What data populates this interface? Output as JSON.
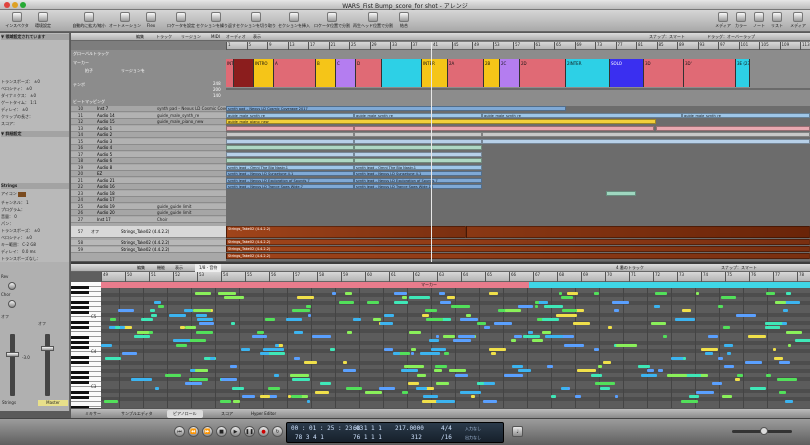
{
  "window": {
    "title": "WARS_Fist Bump_score_for shot - アレンジ"
  },
  "toolbar": {
    "left": [
      "インスペクタ",
      "環境設定",
      "自動的に拡大/縮小",
      "オートメーション",
      "Flex"
    ],
    "mid": [
      "ロケータを設定",
      "セクションを繰り返す",
      "セクションを切り取り",
      "セクションを挿入",
      "ロケータ位置で分割",
      "再生ヘッド位置で分割",
      "結合"
    ],
    "right": [
      "メディア",
      "カラー",
      "ノート",
      "リスト",
      "メディア"
    ]
  },
  "arrange_bar": {
    "items": [
      "編集",
      "トラック",
      "リージョン",
      "MIDI",
      "オーディオ",
      "表示"
    ],
    "snap": "スナップ：スマート",
    "drag": "ドラッグ：オーバーラップ"
  },
  "ruler_ticks": [
    "1",
    "5",
    "9",
    "13",
    "17",
    "21",
    "25",
    "29",
    "33",
    "37",
    "41",
    "45",
    "49",
    "53",
    "57",
    "61",
    "65",
    "69",
    "73",
    "77",
    "81",
    "85",
    "89",
    "93",
    "97",
    "101",
    "105",
    "109",
    "113"
  ],
  "globals": {
    "labels": [
      "グローバルトラック",
      "マーカー",
      "拍子",
      "リージョンを",
      "テンポ",
      "ビートマッピング"
    ],
    "tempo_values": [
      "248",
      "200",
      "140"
    ]
  },
  "markers": [
    {
      "label": "INTRO",
      "color": "#e06a75"
    },
    {
      "label": "",
      "color": "#8b1d1d"
    },
    {
      "label": "INTRO",
      "color": "#f5c518"
    },
    {
      "label": "A",
      "color": "#e06a75"
    },
    {
      "label": "B",
      "color": "#f5c518"
    },
    {
      "label": "C",
      "color": "#b47df0"
    },
    {
      "label": "D",
      "color": "#e06a75"
    },
    {
      "label": "",
      "color": "#2dd0e6"
    },
    {
      "label": "INTER",
      "color": "#f5c518"
    },
    {
      "label": "2A",
      "color": "#e06a75"
    },
    {
      "label": "2B",
      "color": "#f5c518"
    },
    {
      "label": "2C",
      "color": "#b47df0"
    },
    {
      "label": "2D",
      "color": "#e06a75"
    },
    {
      "label": "2INTER",
      "color": "#2dd0e6"
    },
    {
      "label": "SOLO",
      "color": "#3a2ff0"
    },
    {
      "label": "3D",
      "color": "#e06a75"
    },
    {
      "label": "3D'",
      "color": "#e06a75"
    },
    {
      "label": "3E (23 T",
      "color": "#2dd0e6"
    }
  ],
  "tracks": [
    {
      "num": "10",
      "name": "Inst 7",
      "region": "synth pad – Nexus LD Cosmic Coverage 2017"
    },
    {
      "num": "11",
      "name": "Audio 14",
      "region": "guide_male_synth_re"
    },
    {
      "num": "12",
      "name": "Audio 15",
      "region": "guide_male_piano_new"
    },
    {
      "num": "13",
      "name": "Audio 1",
      "region": ""
    },
    {
      "num": "14",
      "name": "Audio 2",
      "region": ""
    },
    {
      "num": "15",
      "name": "Audio 3",
      "region": ""
    },
    {
      "num": "16",
      "name": "Audio 4",
      "region": ""
    },
    {
      "num": "17",
      "name": "Audio 5",
      "region": ""
    },
    {
      "num": "18",
      "name": "Audio 6",
      "region": ""
    },
    {
      "num": "19",
      "name": "Audio 8",
      "region": ""
    },
    {
      "num": "20",
      "name": "EZ",
      "region": ""
    },
    {
      "num": "21",
      "name": "Audio 21",
      "region": ""
    },
    {
      "num": "22",
      "name": "Audio 16",
      "region": ""
    },
    {
      "num": "23",
      "name": "Audio 18",
      "region": ""
    },
    {
      "num": "24",
      "name": "Audio 17",
      "region": ""
    },
    {
      "num": "25",
      "name": "Audio 19",
      "region": "guide_guide limit"
    },
    {
      "num": "26",
      "name": "Audio 20",
      "region": "guide_guide limit"
    },
    {
      "num": "27",
      "name": "Inst 17",
      "region": "Choir"
    }
  ],
  "strings_track": {
    "num": "57",
    "name": "Strings_Take02 (4.4.2.2)",
    "off": "オフ"
  },
  "strings_track_2": {
    "num": "58",
    "name": "Strings_Take02 (4.4.2.2)"
  },
  "strings_track_3": {
    "num": "59",
    "name": "Strings_Take02 (4.4.2.2)"
  },
  "regions_text": [
    "synth pad – Nexus LD Cosmic Coverage 2017",
    "guide_male_synth_re",
    "guide_male_piano_new",
    "synth lead – Omni The Big Nasty.1",
    "synth lead – Nexus LD Sunsetune 4.1",
    "synth lead – Nexus LD Exploration of Sounds.7",
    "synth lead – Nexus LD Trance Saws Wide.7",
    "synth lead – Nexus LD Trance Saws Wide.10",
    "Strings_Take02 (4.4.2.2)"
  ],
  "inspector": {
    "header": "▼ 領域設定されています",
    "rows": [
      "トランスポーズ：",
      "ベロシティ：",
      "ダイナミクス：",
      "ゲートタイム：",
      "ディレイ：",
      "クリップの長さ：",
      "スコア："
    ],
    "values": [
      "±0",
      "±0",
      "±0",
      "1:1",
      "±0",
      "",
      ""
    ],
    "track_header": "▼ 詳細設定",
    "track_name": "Strings",
    "icon": "アイコン",
    "mix_labels": [
      "チャンネル：",
      "プログラム：",
      "音量：",
      "パン：",
      "トランスポーズ：",
      "ベロシティ：",
      "キー範囲：",
      "ディレイ：",
      "トランスポーズなし：",
      "リセットなし：",
      "スタイル："
    ],
    "mix_values": [
      "1",
      "",
      "0",
      "",
      "±0",
      "±0",
      "C-2 G8",
      "0.0 ms",
      "",
      "",
      "Auto"
    ]
  },
  "editor": {
    "bar_items": [
      "編集",
      "機能",
      "表示"
    ],
    "quantize": "1/8 - 音符",
    "right_info": "4 番のトラック",
    "snap": "スナップ：スマート",
    "region_label": "マーカー",
    "octave_labels": [
      "C5",
      "C4",
      "C3"
    ]
  },
  "mixer_strip": {
    "labels": [
      "Rev",
      "Chor",
      "オフ",
      "オフ"
    ],
    "fader_value": "-3.0",
    "name": "Strings",
    "master": "Master"
  },
  "bottom_tabs": [
    "ミキサー",
    "サンプルエディタ",
    "ピアノロール",
    "スコア",
    "Hyper Editor"
  ],
  "active_tab": "ピアノロール",
  "transport": {
    "smpte": "00 : 01 : 25 : 23.03",
    "bars": "78    3    4    1",
    "locL": "68    1    1    1",
    "locR": "76    1    1    1",
    "tempo": "217.0000",
    "division": "312",
    "sig_top": "4/4",
    "sig_bot": "/16",
    "in": "入力なし",
    "out": "出力なし"
  }
}
